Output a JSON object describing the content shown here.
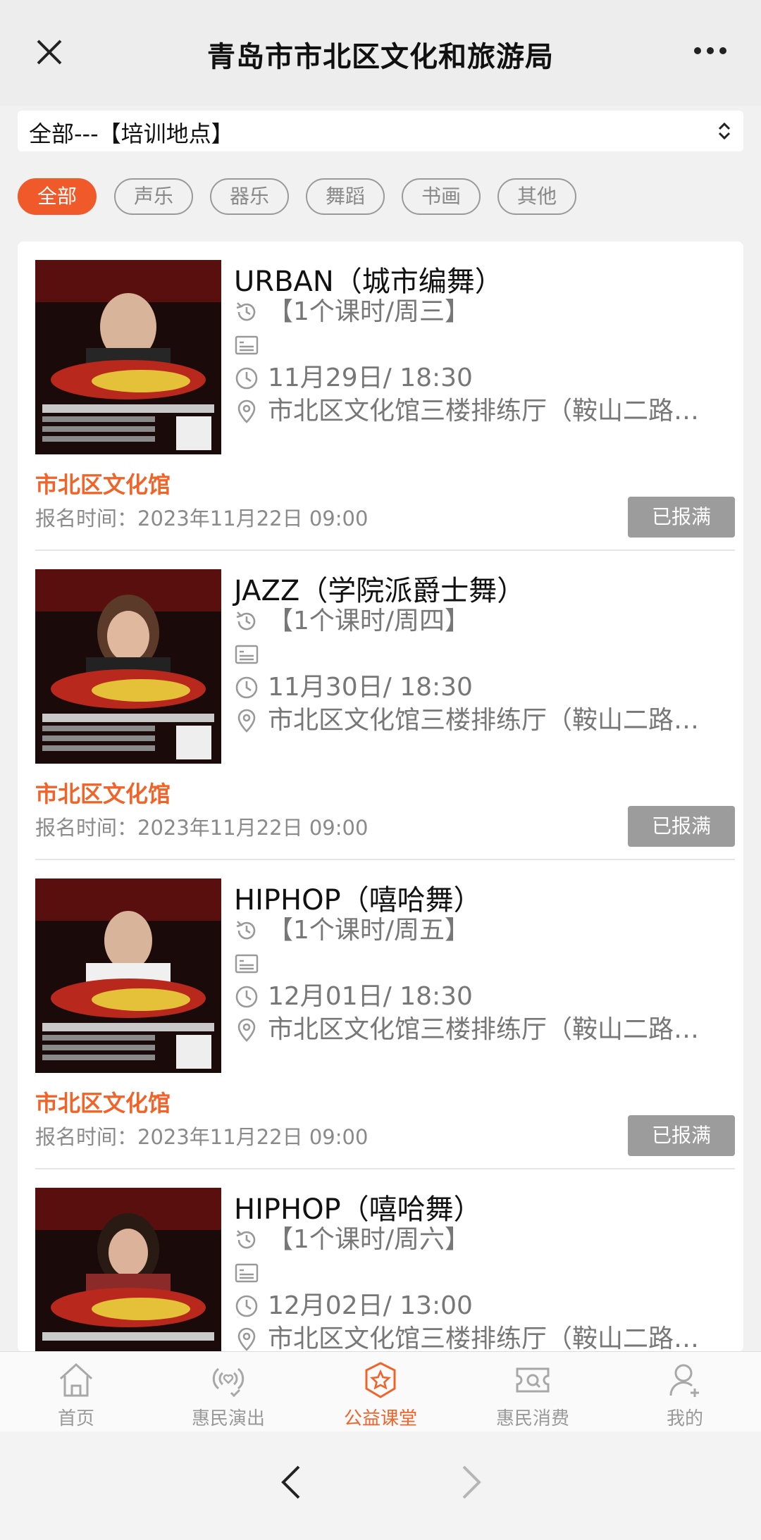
{
  "header": {
    "title": "青岛市市北区文化和旅游局"
  },
  "filter": {
    "label": "全部---【培训地点】"
  },
  "categories": [
    "全部",
    "声乐",
    "器乐",
    "舞蹈",
    "书画",
    "其他"
  ],
  "items": [
    {
      "title": "URBAN（城市编舞）",
      "schedule": "【1个课时/周三】",
      "datetime": "11月29日/ 18:30",
      "location": "市北区文化馆三楼排练厅（鞍山二路…",
      "venue": "市北区文化馆",
      "reg_time": "报名时间：2023年11月22日 09:00",
      "status": "已报满"
    },
    {
      "title": "JAZZ（学院派爵士舞）",
      "schedule": "【1个课时/周四】",
      "datetime": "11月30日/ 18:30",
      "location": "市北区文化馆三楼排练厅（鞍山二路…",
      "venue": "市北区文化馆",
      "reg_time": "报名时间：2023年11月22日 09:00",
      "status": "已报满"
    },
    {
      "title": "HIPHOP（嘻哈舞）",
      "schedule": "【1个课时/周五】",
      "datetime": "12月01日/ 18:30",
      "location": "市北区文化馆三楼排练厅（鞍山二路…",
      "venue": "市北区文化馆",
      "reg_time": "报名时间：2023年11月22日 09:00",
      "status": "已报满"
    },
    {
      "title": "HIPHOP（嘻哈舞）",
      "schedule": "【1个课时/周六】",
      "datetime": "12月02日/ 13:00",
      "location": "市北区文化馆三楼排练厅（鞍山二路…",
      "venue": "",
      "reg_time": "",
      "status": ""
    }
  ],
  "tabs": [
    {
      "label": "首页",
      "icon": "home-icon"
    },
    {
      "label": "惠民演出",
      "icon": "performance-icon"
    },
    {
      "label": "公益课堂",
      "icon": "class-star-icon"
    },
    {
      "label": "惠民消费",
      "icon": "coupon-icon"
    },
    {
      "label": "我的",
      "icon": "user-icon"
    }
  ],
  "colors": {
    "accent": "#f05a2a",
    "button_gray": "#9c9c9c"
  }
}
